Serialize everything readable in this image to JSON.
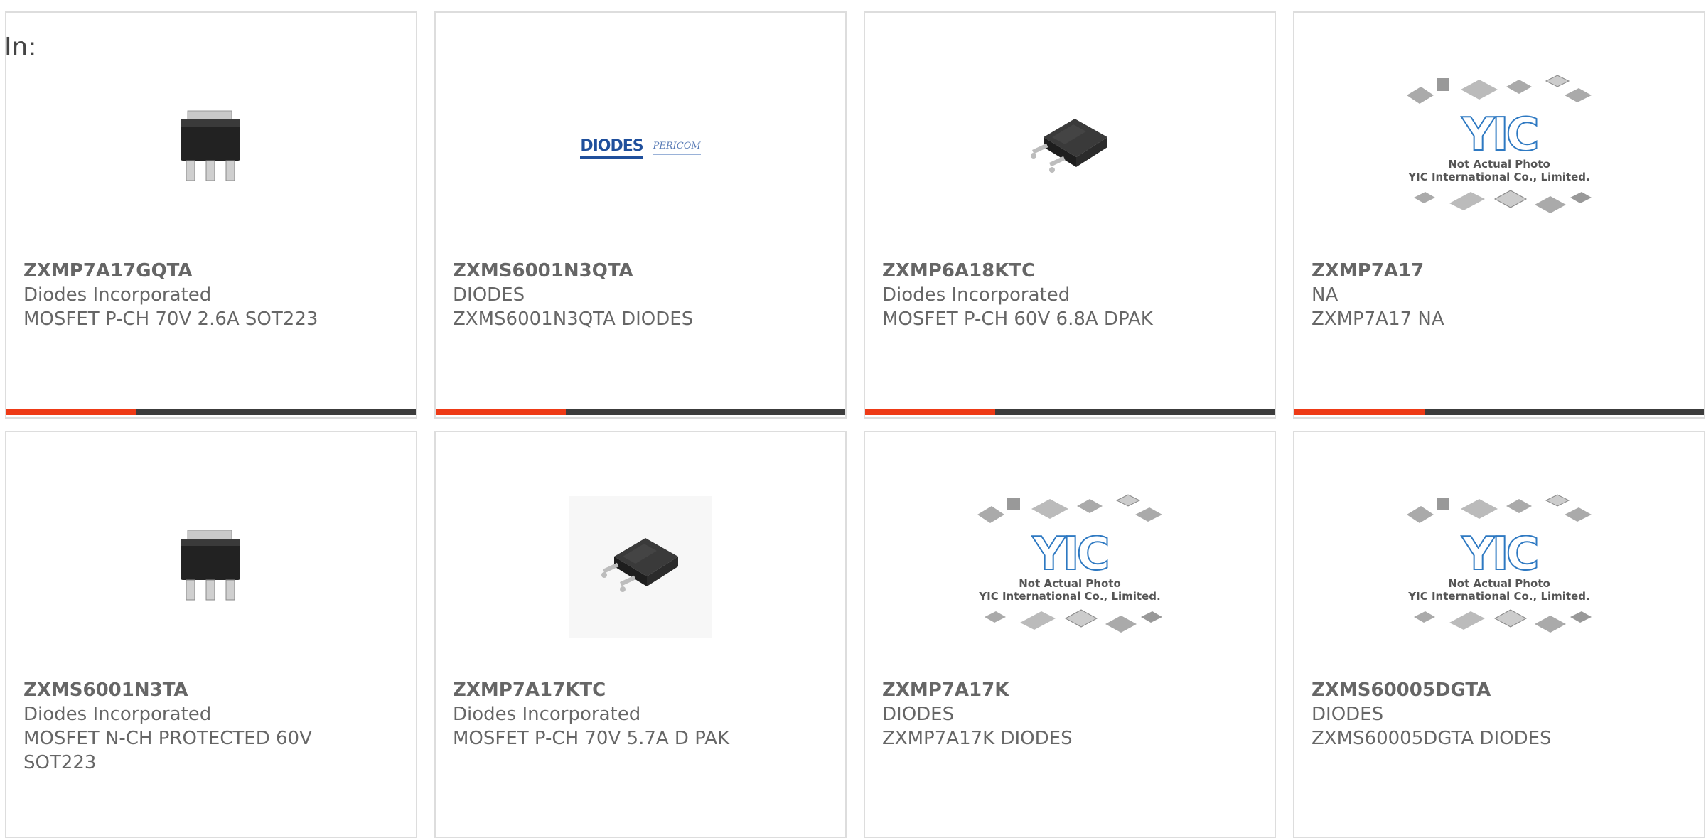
{
  "page": {
    "label": "In:"
  },
  "colors": {
    "accent": "#ee3a16",
    "bar": "#3c3c3c",
    "card_border": "#dddddd",
    "text": "#666666"
  },
  "cards": [
    {
      "part_number": "ZXMP7A17GQTA",
      "manufacturer": "Diodes Incorporated",
      "description": "MOSFET P-CH 70V 2.6A SOT223",
      "image": "sot223-photo"
    },
    {
      "part_number": "ZXMS6001N3QTA",
      "manufacturer": "DIODES",
      "description": "ZXMS6001N3QTA DIODES",
      "image": "diodes-pericom-logo",
      "logo_text": {
        "brand": "DIODES",
        "sub": "PERICOM"
      }
    },
    {
      "part_number": "ZXMP6A18KTC",
      "manufacturer": "Diodes Incorporated",
      "description": "MOSFET P-CH 60V 6.8A DPAK",
      "image": "dpak-photo"
    },
    {
      "part_number": "ZXMP7A17",
      "manufacturer": "NA",
      "description": "ZXMP7A17 NA",
      "image": "yic-placeholder"
    },
    {
      "part_number": "ZXMS6001N3TA",
      "manufacturer": "Diodes Incorporated",
      "description": "MOSFET N-CH PROTECTED 60V SOT223",
      "image": "sot223-photo"
    },
    {
      "part_number": "ZXMP7A17KTC",
      "manufacturer": "Diodes Incorporated",
      "description": "MOSFET P-CH 70V 5.7A D PAK",
      "image": "dpak-photo"
    },
    {
      "part_number": "ZXMP7A17K",
      "manufacturer": "DIODES",
      "description": "ZXMP7A17K DIODES",
      "image": "yic-placeholder"
    },
    {
      "part_number": "ZXMS60005DGTA",
      "manufacturer": "DIODES",
      "description": "ZXMS60005DGTA DIODES",
      "image": "yic-placeholder"
    }
  ],
  "yic": {
    "letters": "YIC",
    "line1": "Not Actual Photo",
    "line2": "YIC International Co., Limited."
  }
}
